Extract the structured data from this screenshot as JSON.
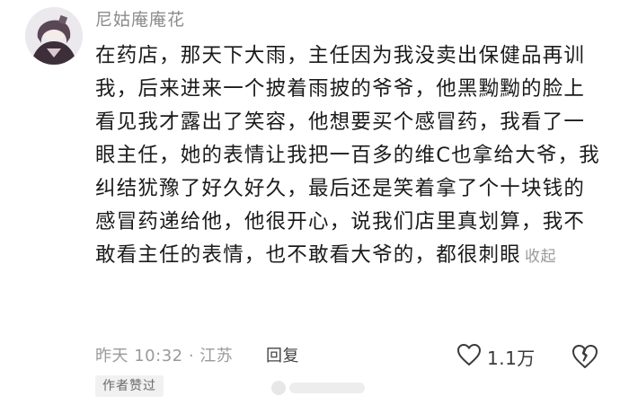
{
  "comment": {
    "username": "尼姑庵庵花",
    "text": "在药店，那天下大雨，主任因为我没卖出保健品再训我，后来进来一个披着雨披的爷爷，他黑黝黝的脸上看见我才露出了笑容，他想要买个感冒药，我看了一眼主任，她的表情让我把一百多的维C也拿给大爷，我纠结犹豫了好久好久，最后还是笑着拿了个十块钱的感冒药递给他，他很开心，说我们店里真划算，我不敢看主任的表情，也不敢看大爷的，都很刺眼",
    "collapse_label": "收起",
    "time_location": "昨天 10:32 · 江苏",
    "reply_label": "回复",
    "like_count": "1.1万",
    "author_liked_badge": "作者赞过"
  },
  "icons": {
    "like": "heart-outline-icon",
    "dislike": "broken-heart-icon"
  },
  "colors": {
    "text": "#1b1b1b",
    "username": "#8c8c8c",
    "meta": "#9a9a9a",
    "badge_bg": "#f1f1f1"
  }
}
